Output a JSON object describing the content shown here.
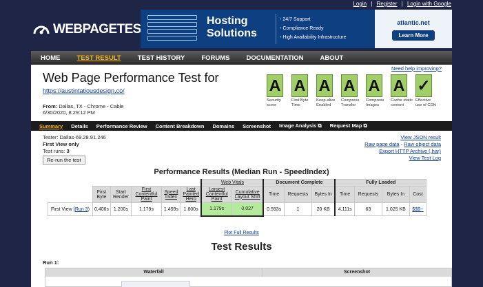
{
  "top_links": {
    "login": "Login",
    "register": "Register",
    "google": "Login with Google",
    "sep": "|"
  },
  "logo": {
    "text": "WEBPAGETEST"
  },
  "ad": {
    "title_line1": "Hosting",
    "title_line2": "Solutions",
    "bullets": [
      "24/7 Support",
      "Compliance Ready",
      "High Availability Infrastructure"
    ],
    "brand": "atlantic.net",
    "button": "Learn More"
  },
  "nav": {
    "items": [
      "HOME",
      "TEST RESULT",
      "TEST HISTORY",
      "FORUMS",
      "DOCUMENTATION",
      "ABOUT"
    ],
    "active": "TEST RESULT"
  },
  "help_link": "Need help improving?",
  "page": {
    "title": "Web Page Performance Test for",
    "url": "https://austintatiousdesign.co/",
    "from_label": "From:",
    "from_value": "Dallas, TX - Chrome - Cable",
    "date": "6/30/2020, 8:29:12 PM"
  },
  "grades": [
    {
      "grade": "A",
      "label": "Security score"
    },
    {
      "grade": "A",
      "label": "First Byte Time"
    },
    {
      "grade": "A",
      "label": "Keep-alive Enabled"
    },
    {
      "grade": "A",
      "label": "Compress Transfer"
    },
    {
      "grade": "A",
      "label": "Compress Images"
    },
    {
      "grade": "A",
      "label": "Cache static content"
    },
    {
      "grade": "✓",
      "label": "Effective use of CDN"
    }
  ],
  "subnav": [
    "Summary",
    "Details",
    "Performance Review",
    "Content Breakdown",
    "Domains",
    "Screenshot",
    "Image Analysis ⧉",
    "Request Map ⧉"
  ],
  "info": {
    "tester": "Tester: Dallas-69.28.91.246",
    "view": "First View only",
    "runs_label": "Test runs:",
    "runs_value": "3",
    "rerun": "Re-run the test"
  },
  "right_links": {
    "json": "View JSON result",
    "raw_page": "Raw page data",
    "dash": " - ",
    "raw_object": "Raw object data",
    "export": "Export HTTP Archive (.har)",
    "log": "View Test Log"
  },
  "perf": {
    "title": "Performance Results (Median Run - SpeedIndex)",
    "groups": {
      "vitals": "Web Vitals",
      "doc": "Document Complete",
      "full": "Fully Loaded"
    },
    "headers": [
      "First Byte",
      "Start Render",
      "First Contentful Paint",
      "Speed Index",
      "Last Painted Hero",
      "Largest Contentful Paint",
      "Cumulative Layout Shift",
      "Time",
      "Requests",
      "Bytes In",
      "Time",
      "Requests",
      "Bytes In",
      "Cost"
    ],
    "row_label": "First View (",
    "row_run": "Run 3",
    "row_close": ")",
    "values": [
      "0.406s",
      "1.200s",
      "1.179s",
      "1.459s",
      "1.800s",
      "1.179s",
      "0.027",
      "0.593s",
      "1",
      "20 KB",
      "4.111s",
      "63",
      "1,025 KB",
      "$$$--"
    ],
    "plot": "Plot Full Results"
  },
  "results": {
    "title": "Test Results",
    "run": "Run 1:",
    "col1": "Waterfall",
    "col2": "Screenshot"
  },
  "colors": {
    "grade_green": "#a2ce69",
    "accent": "#f5b41c",
    "vitals_green": "#b4ea9c",
    "background": "#1e2546"
  }
}
